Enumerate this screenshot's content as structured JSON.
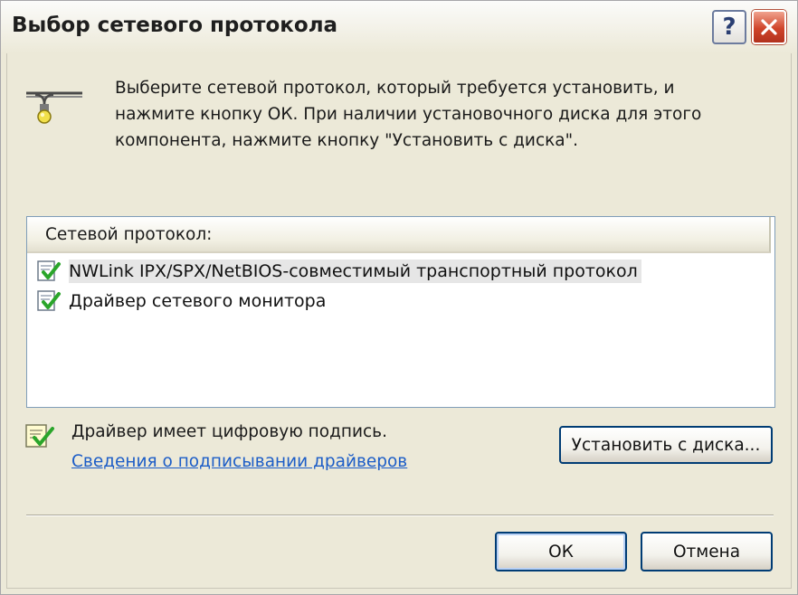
{
  "window": {
    "title": "Выбор сетевого протокола"
  },
  "title_buttons": {
    "help_glyph": "?",
    "close_glyph": "✕"
  },
  "instructions": "Выберите сетевой протокол, который требуется установить, и нажмите кнопку ОК. При наличии установочного диска для этого компонента, нажмите кнопку \"Установить с диска\".",
  "list": {
    "header": "Сетевой протокол:",
    "items": [
      {
        "label": "NWLink IPX/SPX/NetBIOS-совместимый транспортный протокол",
        "selected": true
      },
      {
        "label": "Драйвер сетевого монитора",
        "selected": false
      }
    ]
  },
  "signature": {
    "status": "Драйвер имеет цифровую подпись.",
    "link": "Сведения о подписывании драйверов"
  },
  "buttons": {
    "install_from_disk": "Установить с диска...",
    "ok": "ОК",
    "cancel": "Отмена"
  },
  "icons": {
    "protocol": "network-protocol-icon",
    "item_check": "signed-check-icon",
    "signed": "signed-document-icon"
  },
  "colors": {
    "window_bg": "#ece9d8",
    "close_button": "#d0442a",
    "link": "#1c5dc7",
    "button_border": "#003c74",
    "list_border": "#7f9db9"
  }
}
